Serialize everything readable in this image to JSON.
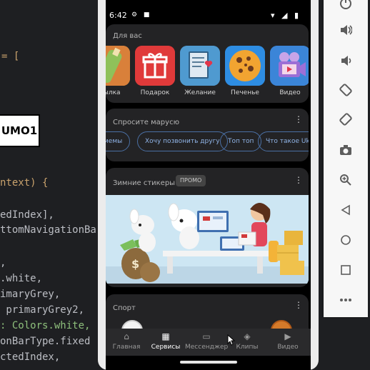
{
  "editor": {
    "lines": [
      {
        "text": "= [",
        "class": "tok-paren"
      },
      {
        "text": "ntext) {",
        "class": "tok-paren"
      },
      {
        "text": "edIndex],",
        "class": "tok-default"
      },
      {
        "text": "ttomNavigationBa",
        "class": "tok-default"
      },
      {
        "text": ",",
        "class": "tok-default"
      },
      {
        "text": ".white,",
        "class": "tok-default"
      },
      {
        "text": "imaryGrey,",
        "class": "tok-default"
      },
      {
        "text": " primaryGrey2,",
        "class": "tok-default"
      },
      {
        "text": ": Colors.white,",
        "class": "tok-green"
      },
      {
        "text": "onBarType.fixed",
        "class": "tok-default"
      },
      {
        "text": "ctedIndex,",
        "class": "tok-default"
      }
    ],
    "id_box": "UMO1"
  },
  "status_bar": {
    "time": "6:42",
    "left_icons": "⚙ ■",
    "right_icons": "▾ ◢ ▮"
  },
  "for_you": {
    "title": "Для вас",
    "apps": [
      {
        "label": "тылка",
        "icon": "bottle-icon"
      },
      {
        "label": "Подарок",
        "icon": "gift-icon"
      },
      {
        "label": "Желание",
        "icon": "wishlist-icon"
      },
      {
        "label": "Печенье",
        "icon": "cookie-icon"
      },
      {
        "label": "Видео",
        "icon": "video-camera-icon"
      }
    ]
  },
  "ask_marusya": {
    "title": "Спросите марусю",
    "chips": [
      "мемы",
      "Хочу позвонить другу",
      "Топ топ",
      "Что такое Uk"
    ]
  },
  "promo": {
    "title": "Зимние стикеры",
    "badge": "ПРОМО"
  },
  "sport": {
    "title": "Спорт"
  },
  "bottom_nav": [
    {
      "label": "Главная",
      "icon": "⌂",
      "active": false
    },
    {
      "label": "Сервисы",
      "icon": "▦",
      "active": true
    },
    {
      "label": "Мессенджер",
      "icon": "▭",
      "active": false
    },
    {
      "label": "Клипы",
      "icon": "◈",
      "active": false
    },
    {
      "label": "Видео",
      "icon": "▶",
      "active": false
    }
  ],
  "toolbar": [
    "power-icon",
    "volume-up-icon",
    "volume-down-icon",
    "rotate-left-icon",
    "rotate-right-icon",
    "camera-icon",
    "zoom-icon",
    "back-icon",
    "home-icon",
    "overview-icon",
    "more-icon"
  ],
  "colors": {
    "card_bg": "#232325",
    "chip_border": "#4a6fa3",
    "chip_text": "#8fb3e6",
    "toolbar_bg": "#f7f7f7"
  }
}
